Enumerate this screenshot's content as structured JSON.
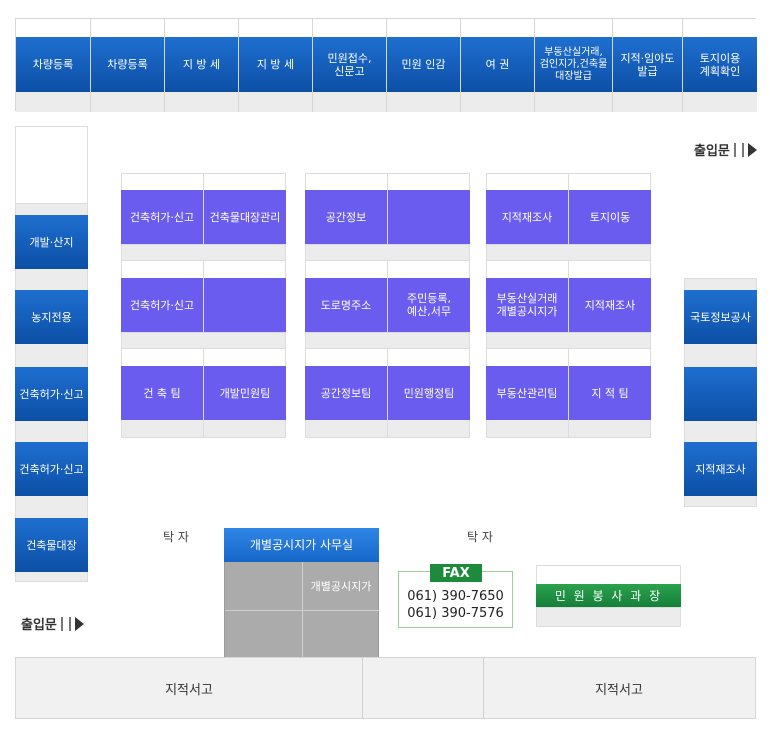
{
  "top_bar": [
    "차량등록",
    "차량등록",
    "지 방 세",
    "지 방 세",
    "민원접수,\n신문고",
    "민원 인감",
    "여   권",
    "부동산실거래,\n검인지가,건축물\n대장발급",
    "지적·임야도\n발급",
    "토지이용\n계획확인"
  ],
  "entrance_label": "출입문",
  "left_column": [
    "개발·산지",
    "농지전용",
    "건축허가·신고",
    "건축허가·신고",
    "건축물대장"
  ],
  "right_column": [
    "국토정보공사",
    "",
    "지적재조사"
  ],
  "group1": {
    "row1": [
      "건축허가·신고",
      "건축물대장관리"
    ],
    "row2": [
      "건축허가·신고",
      ""
    ],
    "row3": [
      "건 축 팀",
      "개발민원팀"
    ]
  },
  "group2": {
    "row1": [
      "공간정보",
      ""
    ],
    "row2": [
      "도로명주소",
      "주민등록,\n예산,서무"
    ],
    "row3": [
      "공간정보팀",
      "민원행정팀"
    ]
  },
  "group3": {
    "row1": [
      "지적재조사",
      "토지이동"
    ],
    "row2": [
      "부동산실거래\n개별공시지가",
      "지적재조사"
    ],
    "row3": [
      "부동산관리팀",
      "지 적 팀"
    ]
  },
  "table_label_left": "탁 자",
  "table_label_right": "탁 자",
  "office": {
    "title": "개별공시지가 사무실",
    "cell": "개별공시지가"
  },
  "fax": {
    "label": "FAX",
    "numbers": [
      "061) 390-7650",
      "061) 390-7576"
    ]
  },
  "service_desk": "민 원 봉 사 과 장",
  "bottom_bar": [
    "지적서고",
    "지적서고"
  ],
  "colors": {
    "blue": "#1565c0",
    "violet": "#6b5cf0",
    "green": "#1e8a3c"
  }
}
